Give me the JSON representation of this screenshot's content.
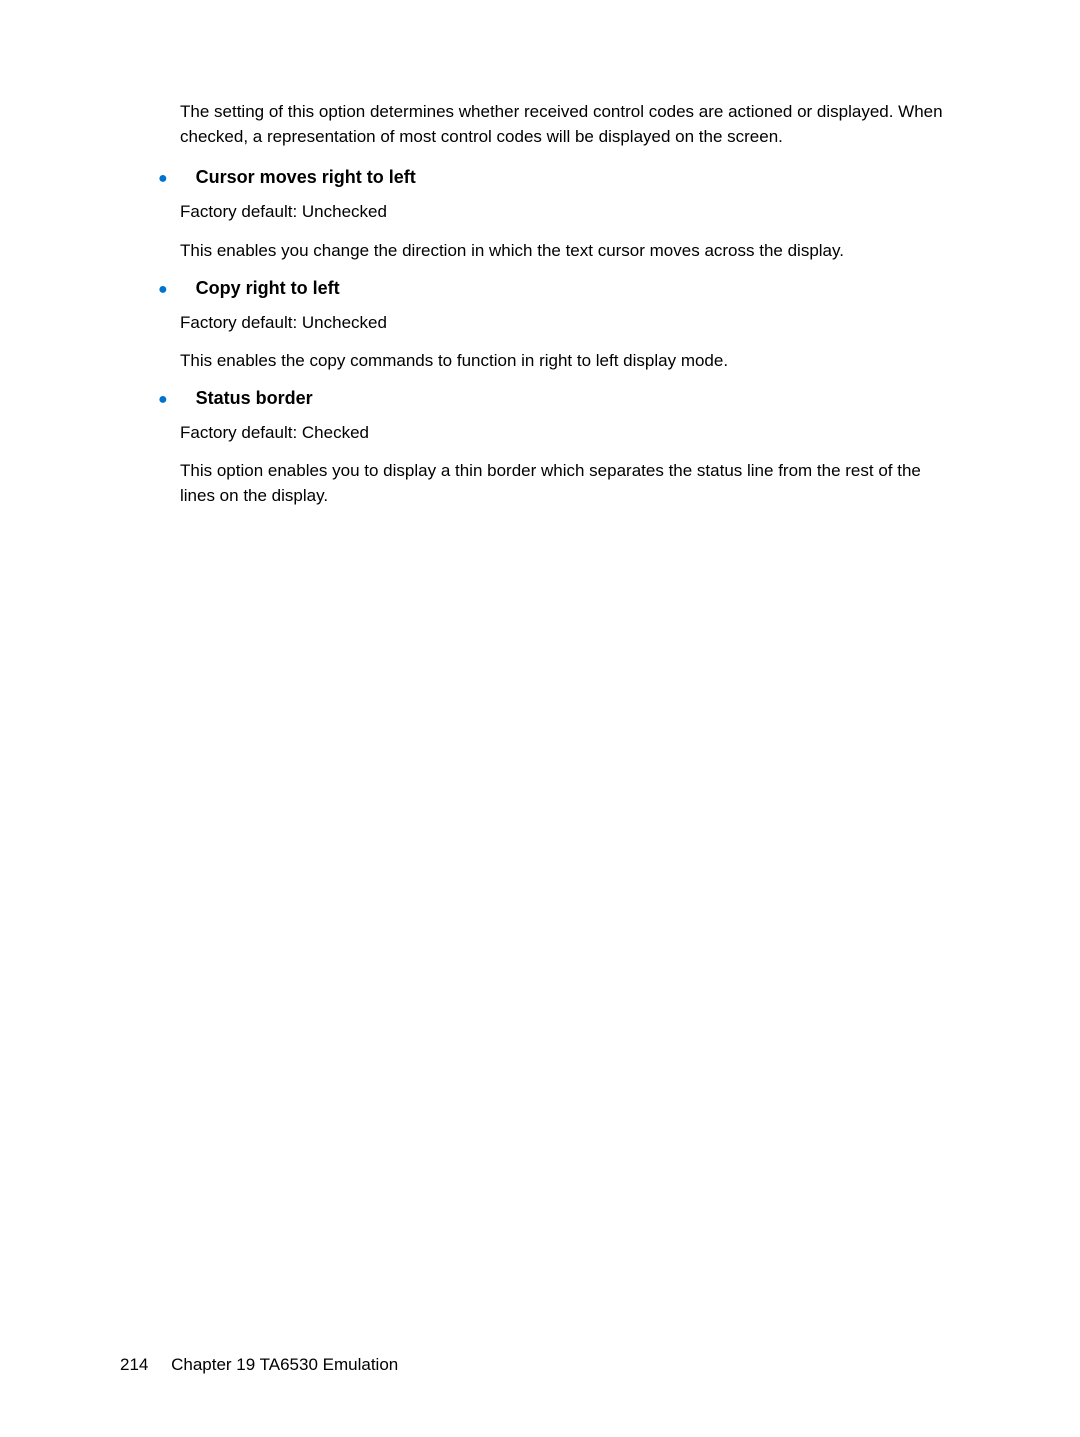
{
  "intro": "The setting of this option determines whether received control codes are actioned or displayed. When checked, a representation of most control codes will be displayed on the screen.",
  "options": [
    {
      "title": "Cursor moves right to left",
      "default": "Factory default: Unchecked",
      "description": "This enables you change the direction in which the text cursor moves across the display."
    },
    {
      "title": "Copy right to left",
      "default": "Factory default: Unchecked",
      "description": "This enables the copy commands to function in right to left display mode."
    },
    {
      "title": "Status border",
      "default": "Factory default: Checked",
      "description": "This option enables you to display a thin border which separates the status line from the rest of the lines on the display."
    }
  ],
  "footer": {
    "pageNumber": "214",
    "chapterText": "Chapter 19   TA6530 Emulation"
  }
}
